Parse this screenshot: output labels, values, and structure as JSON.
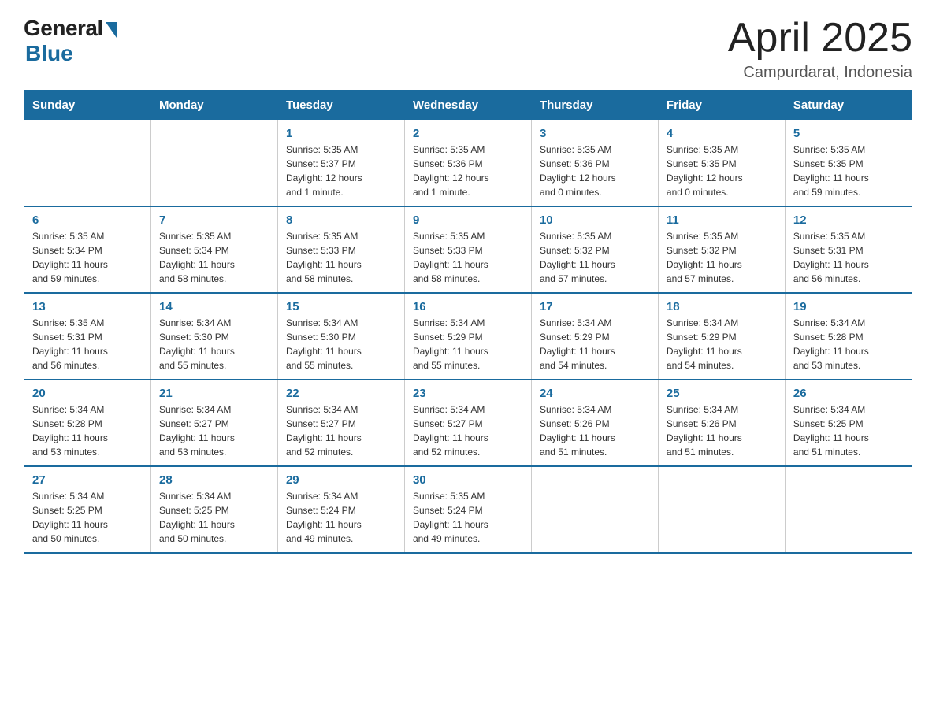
{
  "header": {
    "title": "April 2025",
    "location": "Campurdarat, Indonesia",
    "logo_general": "General",
    "logo_blue": "Blue"
  },
  "weekdays": [
    "Sunday",
    "Monday",
    "Tuesday",
    "Wednesday",
    "Thursday",
    "Friday",
    "Saturday"
  ],
  "weeks": [
    [
      {
        "day": "",
        "info": ""
      },
      {
        "day": "",
        "info": ""
      },
      {
        "day": "1",
        "info": "Sunrise: 5:35 AM\nSunset: 5:37 PM\nDaylight: 12 hours\nand 1 minute."
      },
      {
        "day": "2",
        "info": "Sunrise: 5:35 AM\nSunset: 5:36 PM\nDaylight: 12 hours\nand 1 minute."
      },
      {
        "day": "3",
        "info": "Sunrise: 5:35 AM\nSunset: 5:36 PM\nDaylight: 12 hours\nand 0 minutes."
      },
      {
        "day": "4",
        "info": "Sunrise: 5:35 AM\nSunset: 5:35 PM\nDaylight: 12 hours\nand 0 minutes."
      },
      {
        "day": "5",
        "info": "Sunrise: 5:35 AM\nSunset: 5:35 PM\nDaylight: 11 hours\nand 59 minutes."
      }
    ],
    [
      {
        "day": "6",
        "info": "Sunrise: 5:35 AM\nSunset: 5:34 PM\nDaylight: 11 hours\nand 59 minutes."
      },
      {
        "day": "7",
        "info": "Sunrise: 5:35 AM\nSunset: 5:34 PM\nDaylight: 11 hours\nand 58 minutes."
      },
      {
        "day": "8",
        "info": "Sunrise: 5:35 AM\nSunset: 5:33 PM\nDaylight: 11 hours\nand 58 minutes."
      },
      {
        "day": "9",
        "info": "Sunrise: 5:35 AM\nSunset: 5:33 PM\nDaylight: 11 hours\nand 58 minutes."
      },
      {
        "day": "10",
        "info": "Sunrise: 5:35 AM\nSunset: 5:32 PM\nDaylight: 11 hours\nand 57 minutes."
      },
      {
        "day": "11",
        "info": "Sunrise: 5:35 AM\nSunset: 5:32 PM\nDaylight: 11 hours\nand 57 minutes."
      },
      {
        "day": "12",
        "info": "Sunrise: 5:35 AM\nSunset: 5:31 PM\nDaylight: 11 hours\nand 56 minutes."
      }
    ],
    [
      {
        "day": "13",
        "info": "Sunrise: 5:35 AM\nSunset: 5:31 PM\nDaylight: 11 hours\nand 56 minutes."
      },
      {
        "day": "14",
        "info": "Sunrise: 5:34 AM\nSunset: 5:30 PM\nDaylight: 11 hours\nand 55 minutes."
      },
      {
        "day": "15",
        "info": "Sunrise: 5:34 AM\nSunset: 5:30 PM\nDaylight: 11 hours\nand 55 minutes."
      },
      {
        "day": "16",
        "info": "Sunrise: 5:34 AM\nSunset: 5:29 PM\nDaylight: 11 hours\nand 55 minutes."
      },
      {
        "day": "17",
        "info": "Sunrise: 5:34 AM\nSunset: 5:29 PM\nDaylight: 11 hours\nand 54 minutes."
      },
      {
        "day": "18",
        "info": "Sunrise: 5:34 AM\nSunset: 5:29 PM\nDaylight: 11 hours\nand 54 minutes."
      },
      {
        "day": "19",
        "info": "Sunrise: 5:34 AM\nSunset: 5:28 PM\nDaylight: 11 hours\nand 53 minutes."
      }
    ],
    [
      {
        "day": "20",
        "info": "Sunrise: 5:34 AM\nSunset: 5:28 PM\nDaylight: 11 hours\nand 53 minutes."
      },
      {
        "day": "21",
        "info": "Sunrise: 5:34 AM\nSunset: 5:27 PM\nDaylight: 11 hours\nand 53 minutes."
      },
      {
        "day": "22",
        "info": "Sunrise: 5:34 AM\nSunset: 5:27 PM\nDaylight: 11 hours\nand 52 minutes."
      },
      {
        "day": "23",
        "info": "Sunrise: 5:34 AM\nSunset: 5:27 PM\nDaylight: 11 hours\nand 52 minutes."
      },
      {
        "day": "24",
        "info": "Sunrise: 5:34 AM\nSunset: 5:26 PM\nDaylight: 11 hours\nand 51 minutes."
      },
      {
        "day": "25",
        "info": "Sunrise: 5:34 AM\nSunset: 5:26 PM\nDaylight: 11 hours\nand 51 minutes."
      },
      {
        "day": "26",
        "info": "Sunrise: 5:34 AM\nSunset: 5:25 PM\nDaylight: 11 hours\nand 51 minutes."
      }
    ],
    [
      {
        "day": "27",
        "info": "Sunrise: 5:34 AM\nSunset: 5:25 PM\nDaylight: 11 hours\nand 50 minutes."
      },
      {
        "day": "28",
        "info": "Sunrise: 5:34 AM\nSunset: 5:25 PM\nDaylight: 11 hours\nand 50 minutes."
      },
      {
        "day": "29",
        "info": "Sunrise: 5:34 AM\nSunset: 5:24 PM\nDaylight: 11 hours\nand 49 minutes."
      },
      {
        "day": "30",
        "info": "Sunrise: 5:35 AM\nSunset: 5:24 PM\nDaylight: 11 hours\nand 49 minutes."
      },
      {
        "day": "",
        "info": ""
      },
      {
        "day": "",
        "info": ""
      },
      {
        "day": "",
        "info": ""
      }
    ]
  ]
}
